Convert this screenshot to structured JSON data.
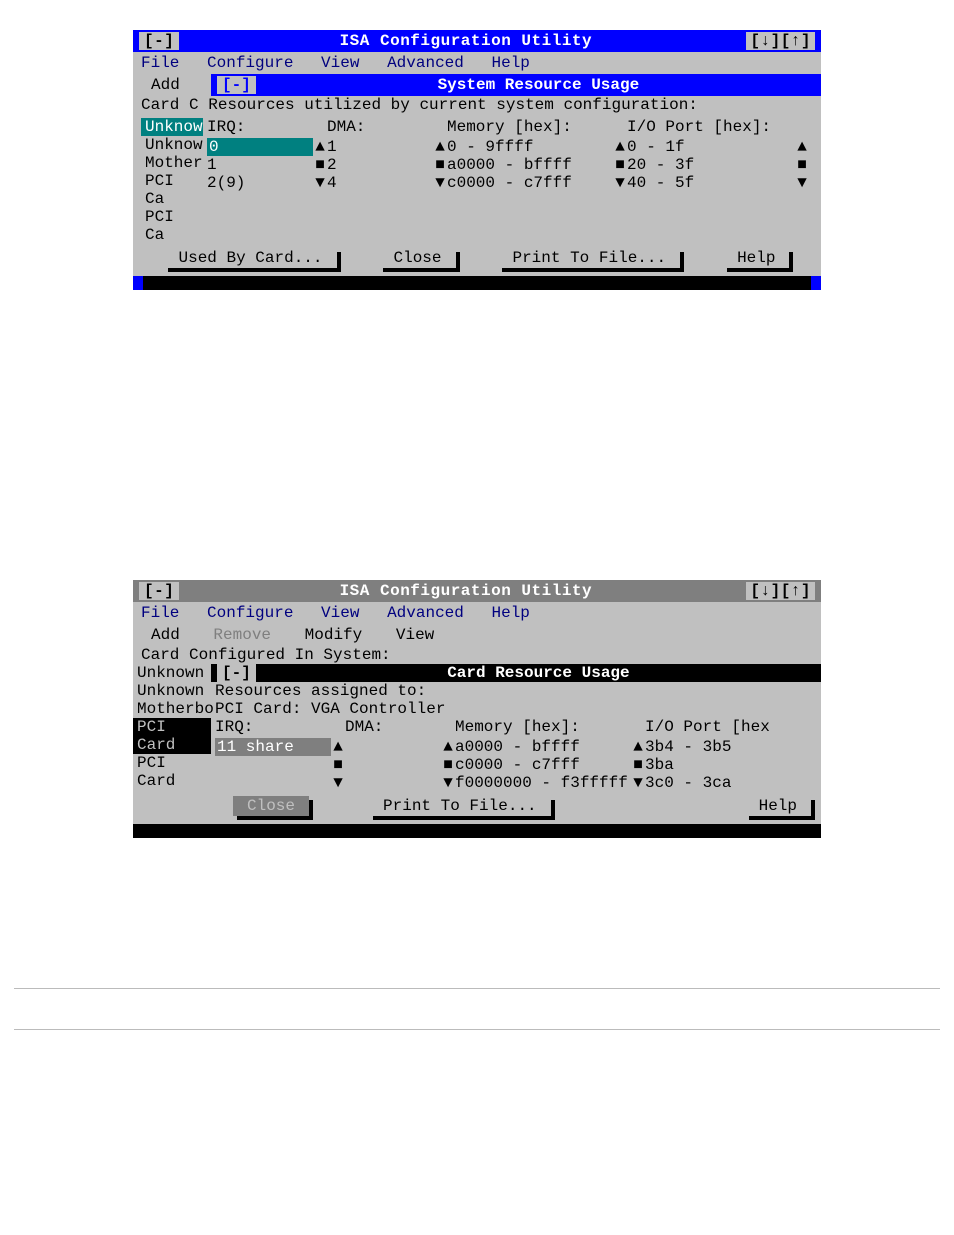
{
  "win1": {
    "title": "ISA Configuration Utility",
    "ctrl_left": "[-]",
    "ctrl_right": "[↓][↑]",
    "menu": [
      "File",
      "Configure",
      "View",
      "Advanced",
      "Help"
    ],
    "submenu": [
      "Add"
    ],
    "dlg_ctrl": "[-]",
    "dlg_title": "System Resource Usage",
    "headline": "Card C Resources utilized by current system configuration:",
    "side_items": [
      "Unknow",
      "Unknow",
      "Mother",
      "PCI Ca",
      "PCI Ca"
    ],
    "side_selected_index": 0,
    "headers": {
      "irq": "IRQ:",
      "dma": "DMA:",
      "mem": "Memory [hex]:",
      "io": "I/O Port [hex]:"
    },
    "rows": [
      {
        "irq": "0",
        "dma": "1",
        "mem": "0 - 9ffff",
        "io": "0 - 1f",
        "mark": "up"
      },
      {
        "irq": "1",
        "dma": "2",
        "mem": "a0000 - bffff",
        "io": "20 - 3f",
        "mark": "sq"
      },
      {
        "irq": "2(9)",
        "dma": "4",
        "mem": "c0000 - c7fff",
        "io": "40 - 5f",
        "mark": "dn"
      }
    ],
    "irq_selected_index": 0,
    "buttons": [
      "Used By Card...",
      "Close",
      "Print To File...",
      "Help"
    ]
  },
  "win2": {
    "title": "ISA Configuration Utility",
    "ctrl_left": "[-]",
    "ctrl_right": "[↓][↑]",
    "menu": [
      "File",
      "Configure",
      "View",
      "Advanced",
      "Help"
    ],
    "submenu": [
      {
        "label": "Add",
        "dim": false
      },
      {
        "label": "Remove",
        "dim": true
      },
      {
        "label": "Modify",
        "dim": false
      },
      {
        "label": "View",
        "dim": false
      }
    ],
    "cfg_line": "Card Configured In System:",
    "side_items": [
      "Unknown",
      "Unknown",
      "Motherbo",
      "PCI Card",
      "PCI Card"
    ],
    "side_selected_index": 3,
    "dlg_ctrl": "[-]",
    "dlg_title": "Card Resource Usage",
    "assigned_label": "Resources assigned to:",
    "assigned_card": "PCI Card: VGA Controller",
    "headers": {
      "irq": "IRQ:",
      "dma": "DMA:",
      "mem": "Memory [hex]:",
      "io": "I/O Port [hex"
    },
    "rows": [
      {
        "irq": "11 share",
        "dma": "",
        "mem": "a0000 - bffff",
        "io": "3b4 - 3b5",
        "mark": "up"
      },
      {
        "irq": "",
        "dma": "",
        "mem": "c0000 - c7fff",
        "io": "3ba",
        "mark": "sq"
      },
      {
        "irq": "",
        "dma": "",
        "mem": "f0000000 - f3fffff",
        "io": "3c0 - 3ca",
        "mark": "dn"
      }
    ],
    "irq_selected_index": 0,
    "buttons": [
      {
        "label": "Close",
        "dim": true
      },
      {
        "label": "Print To File...",
        "dim": false
      },
      {
        "label": "Help",
        "dim": false
      }
    ]
  }
}
